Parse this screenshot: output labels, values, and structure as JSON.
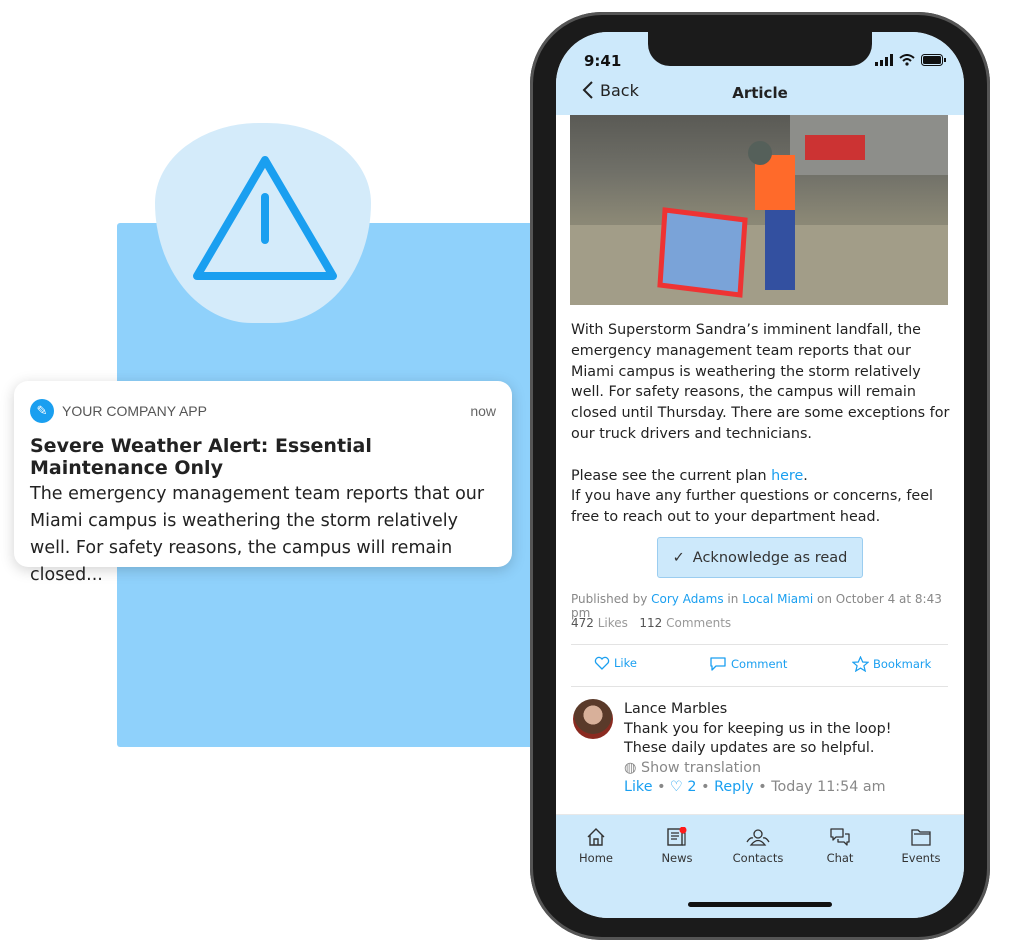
{
  "notification": {
    "app_name": "YOUR COMPANY APP",
    "time": "now",
    "title": "Severe Weather Alert: Essential Maintenance Only",
    "body": "The emergency management team reports that our Miami campus is weathering the storm relatively well. For safety reasons, the campus will remain closed..."
  },
  "status": {
    "time": "9:41"
  },
  "header": {
    "back": "Back",
    "title": "Article"
  },
  "article": {
    "p1": "With Superstorm Sandra’s imminent landfall, the emergency management team reports that our Miami campus is weathering the storm relatively well. For safety reasons, the campus will remain closed until Thursday. There are some exceptions for our truck drivers and technicians.",
    "p2_pre": "Please see the current plan ",
    "p2_link": "here",
    "p2_post": ".",
    "p3": "If you have any further questions or concerns, feel free to reach out to your department head.",
    "ack": "Acknowledge as read"
  },
  "meta": {
    "published_by": "Published by ",
    "author": "Cory Adams",
    "in": " in ",
    "channel": "Local Miami",
    "date": " on October 4 at 8:43 pm",
    "likes": "472",
    "likes_label": "Likes",
    "comments": "112",
    "comments_label": "Comments"
  },
  "actions": {
    "like": "Like",
    "comment": "Comment",
    "bookmark": "Bookmark"
  },
  "comment": {
    "author": "Lance Marbles",
    "line1": "Thank you for keeping us in the loop!",
    "line2": "These daily updates are so helpful.",
    "translate": "Show translation",
    "like": "Like",
    "likes": "2",
    "reply": "Reply",
    "time": "Today 11:54 am"
  },
  "tabs": [
    {
      "label": "Home",
      "icon": "home-icon"
    },
    {
      "label": "News",
      "icon": "news-icon",
      "badge": true
    },
    {
      "label": "Contacts",
      "icon": "contacts-icon"
    },
    {
      "label": "Chat",
      "icon": "chat-icon"
    },
    {
      "label": "Events",
      "icon": "folder-icon"
    }
  ],
  "colors": {
    "accent": "#1a9ff0",
    "light_blue": "#cde9fb",
    "badge": "#ff1a1a"
  }
}
